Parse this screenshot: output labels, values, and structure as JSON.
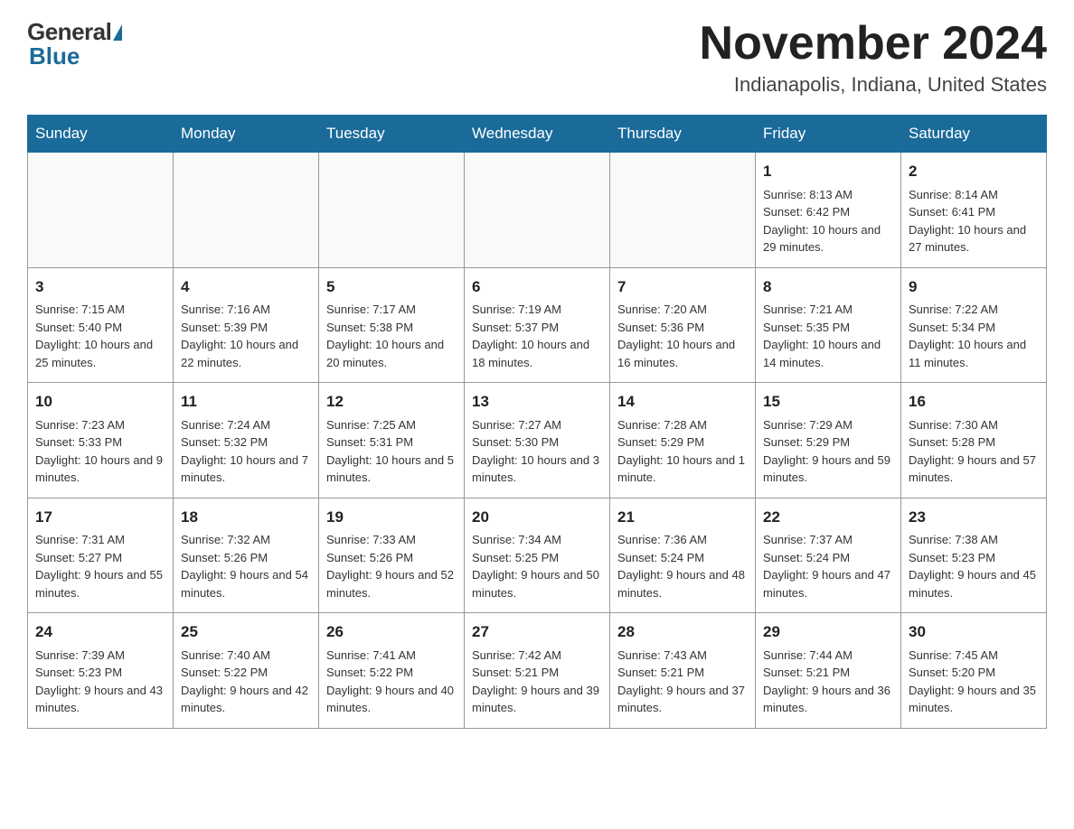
{
  "logo": {
    "general": "General",
    "blue": "Blue"
  },
  "title": "November 2024",
  "location": "Indianapolis, Indiana, United States",
  "days_of_week": [
    "Sunday",
    "Monday",
    "Tuesday",
    "Wednesday",
    "Thursday",
    "Friday",
    "Saturday"
  ],
  "weeks": [
    [
      {
        "day": "",
        "info": ""
      },
      {
        "day": "",
        "info": ""
      },
      {
        "day": "",
        "info": ""
      },
      {
        "day": "",
        "info": ""
      },
      {
        "day": "",
        "info": ""
      },
      {
        "day": "1",
        "info": "Sunrise: 8:13 AM\nSunset: 6:42 PM\nDaylight: 10 hours and 29 minutes."
      },
      {
        "day": "2",
        "info": "Sunrise: 8:14 AM\nSunset: 6:41 PM\nDaylight: 10 hours and 27 minutes."
      }
    ],
    [
      {
        "day": "3",
        "info": "Sunrise: 7:15 AM\nSunset: 5:40 PM\nDaylight: 10 hours and 25 minutes."
      },
      {
        "day": "4",
        "info": "Sunrise: 7:16 AM\nSunset: 5:39 PM\nDaylight: 10 hours and 22 minutes."
      },
      {
        "day": "5",
        "info": "Sunrise: 7:17 AM\nSunset: 5:38 PM\nDaylight: 10 hours and 20 minutes."
      },
      {
        "day": "6",
        "info": "Sunrise: 7:19 AM\nSunset: 5:37 PM\nDaylight: 10 hours and 18 minutes."
      },
      {
        "day": "7",
        "info": "Sunrise: 7:20 AM\nSunset: 5:36 PM\nDaylight: 10 hours and 16 minutes."
      },
      {
        "day": "8",
        "info": "Sunrise: 7:21 AM\nSunset: 5:35 PM\nDaylight: 10 hours and 14 minutes."
      },
      {
        "day": "9",
        "info": "Sunrise: 7:22 AM\nSunset: 5:34 PM\nDaylight: 10 hours and 11 minutes."
      }
    ],
    [
      {
        "day": "10",
        "info": "Sunrise: 7:23 AM\nSunset: 5:33 PM\nDaylight: 10 hours and 9 minutes."
      },
      {
        "day": "11",
        "info": "Sunrise: 7:24 AM\nSunset: 5:32 PM\nDaylight: 10 hours and 7 minutes."
      },
      {
        "day": "12",
        "info": "Sunrise: 7:25 AM\nSunset: 5:31 PM\nDaylight: 10 hours and 5 minutes."
      },
      {
        "day": "13",
        "info": "Sunrise: 7:27 AM\nSunset: 5:30 PM\nDaylight: 10 hours and 3 minutes."
      },
      {
        "day": "14",
        "info": "Sunrise: 7:28 AM\nSunset: 5:29 PM\nDaylight: 10 hours and 1 minute."
      },
      {
        "day": "15",
        "info": "Sunrise: 7:29 AM\nSunset: 5:29 PM\nDaylight: 9 hours and 59 minutes."
      },
      {
        "day": "16",
        "info": "Sunrise: 7:30 AM\nSunset: 5:28 PM\nDaylight: 9 hours and 57 minutes."
      }
    ],
    [
      {
        "day": "17",
        "info": "Sunrise: 7:31 AM\nSunset: 5:27 PM\nDaylight: 9 hours and 55 minutes."
      },
      {
        "day": "18",
        "info": "Sunrise: 7:32 AM\nSunset: 5:26 PM\nDaylight: 9 hours and 54 minutes."
      },
      {
        "day": "19",
        "info": "Sunrise: 7:33 AM\nSunset: 5:26 PM\nDaylight: 9 hours and 52 minutes."
      },
      {
        "day": "20",
        "info": "Sunrise: 7:34 AM\nSunset: 5:25 PM\nDaylight: 9 hours and 50 minutes."
      },
      {
        "day": "21",
        "info": "Sunrise: 7:36 AM\nSunset: 5:24 PM\nDaylight: 9 hours and 48 minutes."
      },
      {
        "day": "22",
        "info": "Sunrise: 7:37 AM\nSunset: 5:24 PM\nDaylight: 9 hours and 47 minutes."
      },
      {
        "day": "23",
        "info": "Sunrise: 7:38 AM\nSunset: 5:23 PM\nDaylight: 9 hours and 45 minutes."
      }
    ],
    [
      {
        "day": "24",
        "info": "Sunrise: 7:39 AM\nSunset: 5:23 PM\nDaylight: 9 hours and 43 minutes."
      },
      {
        "day": "25",
        "info": "Sunrise: 7:40 AM\nSunset: 5:22 PM\nDaylight: 9 hours and 42 minutes."
      },
      {
        "day": "26",
        "info": "Sunrise: 7:41 AM\nSunset: 5:22 PM\nDaylight: 9 hours and 40 minutes."
      },
      {
        "day": "27",
        "info": "Sunrise: 7:42 AM\nSunset: 5:21 PM\nDaylight: 9 hours and 39 minutes."
      },
      {
        "day": "28",
        "info": "Sunrise: 7:43 AM\nSunset: 5:21 PM\nDaylight: 9 hours and 37 minutes."
      },
      {
        "day": "29",
        "info": "Sunrise: 7:44 AM\nSunset: 5:21 PM\nDaylight: 9 hours and 36 minutes."
      },
      {
        "day": "30",
        "info": "Sunrise: 7:45 AM\nSunset: 5:20 PM\nDaylight: 9 hours and 35 minutes."
      }
    ]
  ]
}
